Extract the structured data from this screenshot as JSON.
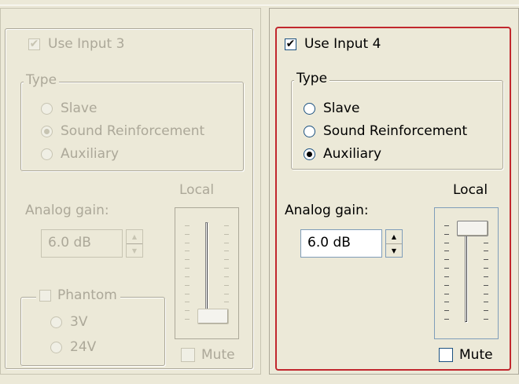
{
  "input3": {
    "use_label": "Use Input 3",
    "use_checked": true,
    "type_label": "Type",
    "options": [
      "Slave",
      "Sound Reinforcement",
      "Auxiliary"
    ],
    "selected_index": 1,
    "local_label": "Local",
    "analog_gain_label": "Analog gain:",
    "gain_value": "6.0 dB",
    "phantom_label": "Phantom",
    "phantom_options": [
      "3V",
      "24V"
    ],
    "mute_label": "Mute",
    "slider_level_fraction": 0.0,
    "enabled": false
  },
  "input4": {
    "use_label": "Use Input 4",
    "use_checked": true,
    "type_label": "Type",
    "options": [
      "Slave",
      "Sound Reinforcement",
      "Auxiliary"
    ],
    "selected_index": 2,
    "local_label": "Local",
    "analog_gain_label": "Analog gain:",
    "gain_value": "6.0 dB",
    "mute_label": "Mute",
    "slider_level_fraction": 1.0,
    "enabled": true
  },
  "colors": {
    "background": "#ece9d8",
    "focus_border": "#c1272d",
    "disabled_text": "#aca899"
  },
  "icons": {
    "check": "checkmark-icon",
    "spin_up": "spin-up-arrow-icon",
    "spin_down": "spin-down-arrow-icon"
  }
}
